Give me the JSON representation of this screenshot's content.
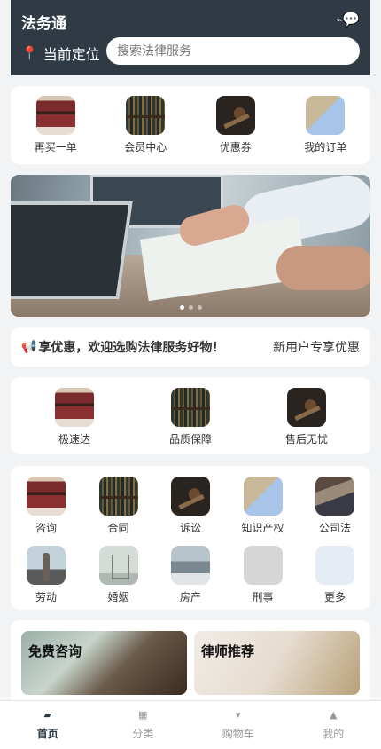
{
  "header": {
    "title": "法务通",
    "icons": [
      "wifi-icon",
      "chat-icon"
    ],
    "location_label": "当前定位",
    "search_placeholder": "搜索法律服务"
  },
  "quick_actions": [
    {
      "label": "再买一单"
    },
    {
      "label": "会员中心"
    },
    {
      "label": "优惠券"
    },
    {
      "label": "我的订单"
    }
  ],
  "banner": {
    "slides": 3,
    "active": 0
  },
  "notice": {
    "text": "享优惠，欢迎选购法律服务好物！",
    "tag": "新用户专享优惠"
  },
  "features": [
    {
      "label": "极速达"
    },
    {
      "label": "品质保障"
    },
    {
      "label": "售后无忧"
    }
  ],
  "categories": [
    {
      "label": "咨询"
    },
    {
      "label": "合同"
    },
    {
      "label": "诉讼"
    },
    {
      "label": "知识产权"
    },
    {
      "label": "公司法"
    },
    {
      "label": "劳动"
    },
    {
      "label": "婚姻"
    },
    {
      "label": "房产"
    },
    {
      "label": "刑事"
    },
    {
      "label": "更多"
    }
  ],
  "promos": [
    {
      "title": "免费咨询"
    },
    {
      "title": "律师推荐"
    }
  ],
  "tabbar": [
    {
      "label": "首页",
      "icon": "home-icon",
      "active": true
    },
    {
      "label": "分类",
      "icon": "grid-icon",
      "active": false
    },
    {
      "label": "购物车",
      "icon": "cart-icon",
      "active": false
    },
    {
      "label": "我的",
      "icon": "user-icon",
      "active": false
    }
  ],
  "colors": {
    "header_bg": "#2f3a45",
    "active_tab": "#2f3a45",
    "pin": "#e54b4b"
  }
}
